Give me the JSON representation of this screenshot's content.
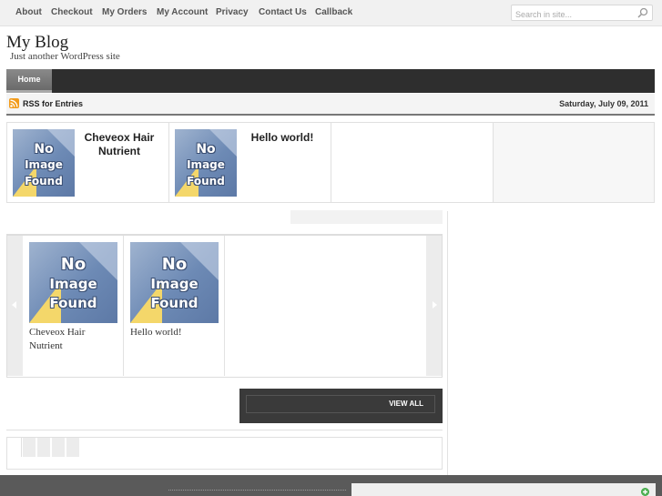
{
  "topnav": {
    "items": [
      "About",
      "Checkout",
      "My Orders",
      "My Account",
      "Privacy",
      "Contact Us",
      "Callback"
    ]
  },
  "search": {
    "placeholder": "Search in site..."
  },
  "site": {
    "title": "My Blog",
    "description": "Just another WordPress site"
  },
  "mainnav": {
    "home": "Home"
  },
  "infobar": {
    "rss": "RSS for Entries",
    "date": "Saturday, July 09, 2011"
  },
  "no_image": {
    "line1": "No",
    "line2": "Image",
    "line3": "Found"
  },
  "featured": [
    {
      "title": "Cheveox Hair Nutrient"
    },
    {
      "title": "Hello world!"
    }
  ],
  "carousel": [
    {
      "caption": "Cheveox Hair Nutrient"
    },
    {
      "caption": "Hello world!"
    }
  ],
  "viewall": {
    "label": "VIEW ALL"
  },
  "colors": {
    "nav_dark": "#2e2e2e",
    "rss_orange": "#f29b1b",
    "footer": "#5a5a5a"
  }
}
